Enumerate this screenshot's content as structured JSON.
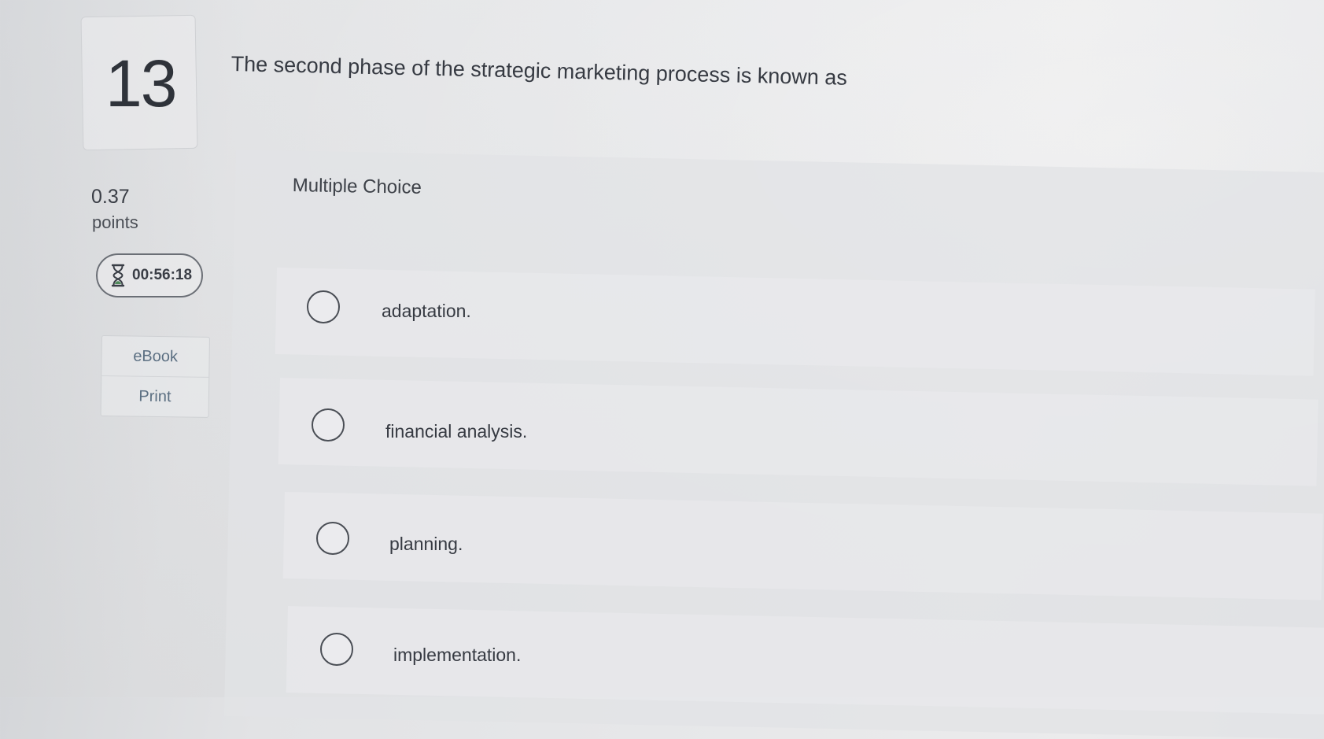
{
  "question": {
    "number": "13",
    "text": "The second phase of the strategic marketing process is known as",
    "type_label": "Multiple Choice"
  },
  "points": {
    "value": "0.37",
    "label": "points"
  },
  "timer": {
    "icon": "hourglass-icon",
    "time": "00:56:18"
  },
  "tools": [
    {
      "label": "eBook"
    },
    {
      "label": "Print"
    }
  ],
  "choices": [
    {
      "label": "adaptation."
    },
    {
      "label": "financial analysis."
    },
    {
      "label": "planning."
    },
    {
      "label": "implementation."
    }
  ]
}
